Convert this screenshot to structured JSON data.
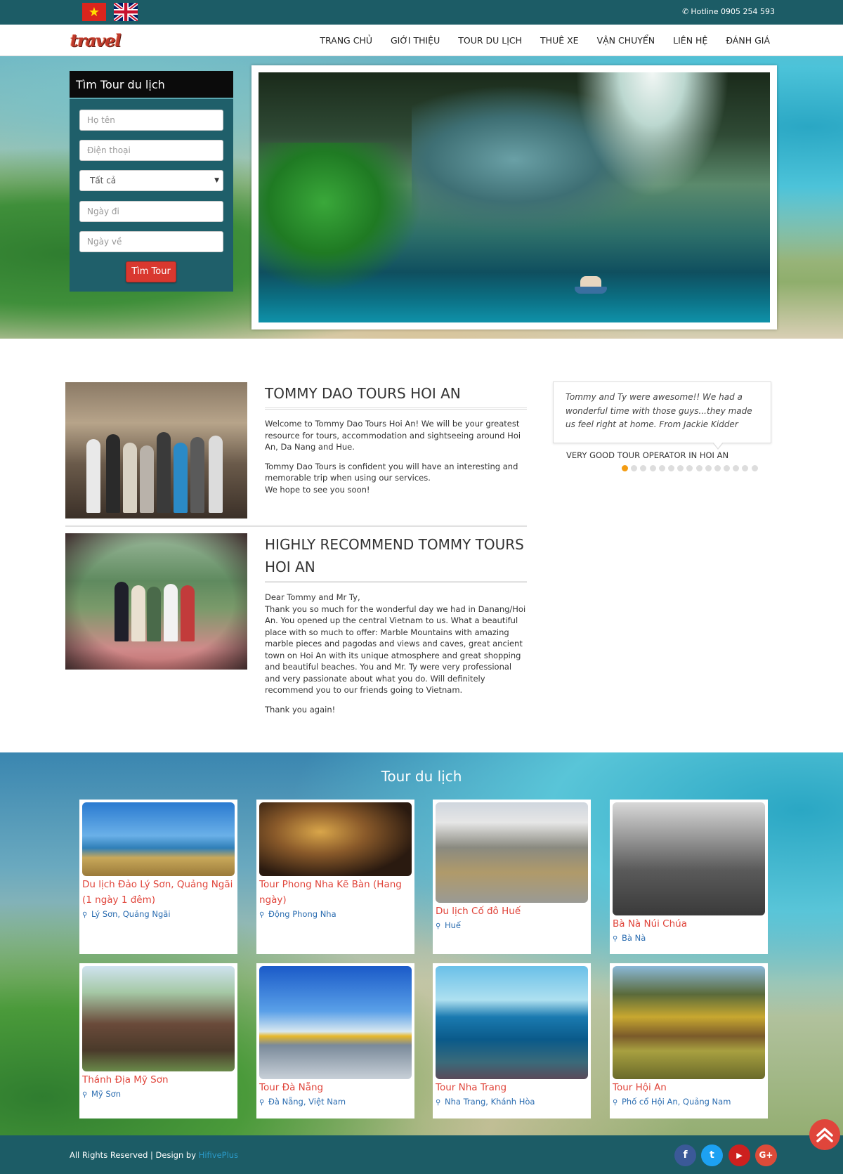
{
  "topbar": {
    "flags": [
      "vietnam-flag",
      "uk-flag"
    ],
    "hotline_icon": "phone-icon",
    "hotline": "Hotline 0905 254 593"
  },
  "nav": {
    "logo": "travel",
    "items": [
      "TRANG CHỦ",
      "GIỚI THIỆU",
      "TOUR DU LỊCH",
      "THUÊ XE",
      "VẬN CHUYỂN",
      "LIÊN HỆ",
      "ĐÁNH GIÁ"
    ]
  },
  "search": {
    "title": "Tìm Tour du lịch",
    "name_placeholder": "Họ tên",
    "phone_placeholder": "Điện thoại",
    "category_selected": "Tất cả",
    "depart_placeholder": "Ngày đi",
    "return_placeholder": "Ngày về",
    "button": "Tìm Tour"
  },
  "stories": [
    {
      "title": "TOMMY DAO TOURS HOI AN",
      "paragraphs": [
        "Welcome to Tommy Dao Tours Hoi An! We will be your greatest resource for tours, accommodation and sightseeing around Hoi An, Da Nang and Hue.",
        "Tommy Dao Tours is confident you will have an interesting and memorable trip when using our services.\nWe hope to see you soon!"
      ]
    },
    {
      "title": "HIGHLY RECOMMEND TOMMY TOURS HOI AN",
      "paragraphs": [
        "Dear Tommy and Mr Ty,\nThank you so much for the wonderful day we had in Danang/Hoi An. You opened up the central Vietnam to us. What a beautiful place with so much to offer: Marble Mountains with amazing marble pieces and pagodas and views and caves, great ancient town on Hoi An with its unique atmosphere and great shopping and beautiful beaches. You and Mr. Ty were very professional and very passionate about what you do. Will definitely recommend you to our friends going to Vietnam.",
        "Thank you again!"
      ]
    }
  ],
  "testimonial": {
    "quote": "Tommy and Ty were awesome!! We had a wonderful time with those guys...they made us feel right at home. From Jackie Kidder",
    "author": "VERY GOOD TOUR OPERATOR IN HOI AN",
    "dot_count": 15,
    "active_dot": 0,
    "active_color": "#f39c12"
  },
  "tours": {
    "title": "Tour du lịch",
    "items": [
      {
        "name": "Du lịch Đảo Lý Sơn, Quảng Ngãi (1 ngày 1 đêm)",
        "location": "Lý Sơn, Quảng Ngãi"
      },
      {
        "name": "Tour Phong Nha Kẽ Bàn (Hang ngày)",
        "location": "Động Phong Nha"
      },
      {
        "name": "Du lịch Cố đô Huế",
        "location": "Huế"
      },
      {
        "name": "Bà Nà Núi Chúa",
        "location": "Bà Nà"
      },
      {
        "name": "Thánh Địa Mỹ Sơn",
        "location": "Mỹ Sơn"
      },
      {
        "name": "Tour Đà Nẵng",
        "location": "Đà Nẵng, Việt Nam"
      },
      {
        "name": "Tour Nha Trang",
        "location": "Nha Trang, Khánh Hòa"
      },
      {
        "name": "Tour Hội An",
        "location": "Phố cổ Hội An, Quảng Nam"
      }
    ]
  },
  "footer": {
    "text": "All Rights Reserved | Design by ",
    "link": "HifivePlus",
    "social": [
      {
        "name": "facebook-icon",
        "glyph": "f",
        "color": "#3b5998"
      },
      {
        "name": "twitter-icon",
        "glyph": "t",
        "color": "#1da1f2"
      },
      {
        "name": "youtube-icon",
        "glyph": "▶",
        "color": "#cd201f"
      },
      {
        "name": "google-plus-icon",
        "glyph": "G+",
        "color": "#dd4b39"
      }
    ]
  },
  "colors": {
    "brand_teal": "#1c5c66",
    "accent_red": "#e0453b",
    "link_blue": "#2a6cb0"
  }
}
